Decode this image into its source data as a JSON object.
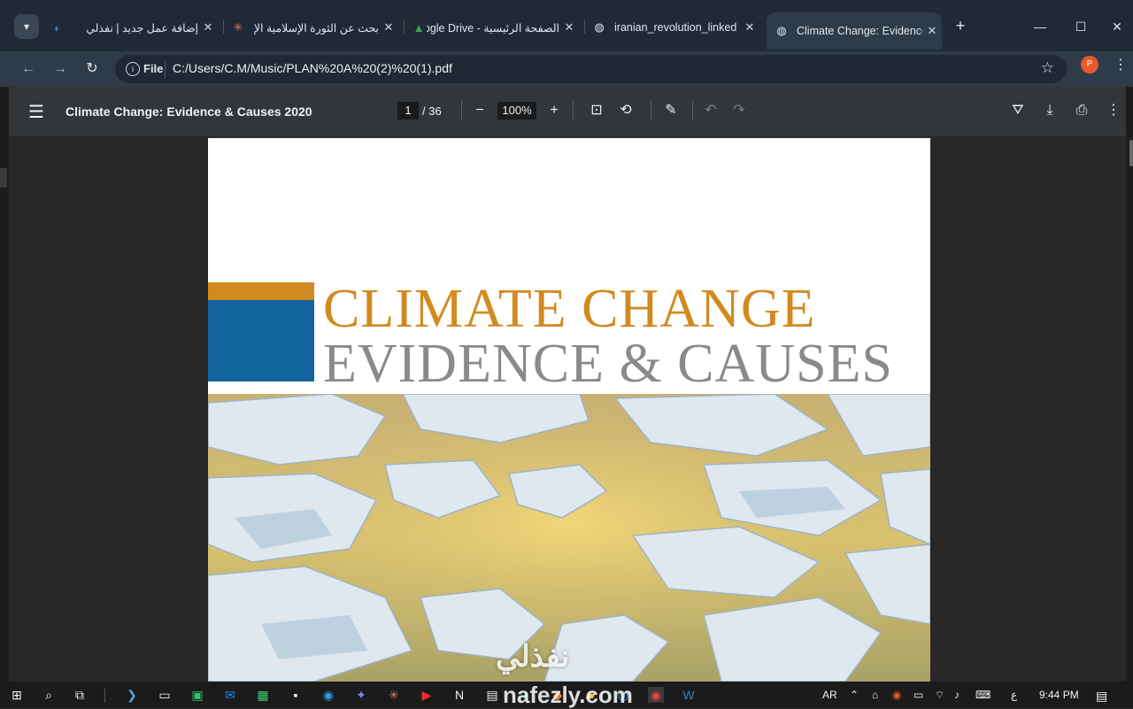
{
  "browser": {
    "tabs": [
      {
        "title": "إضافة عمل جديد | نفذلي",
        "favicon": "nafzly-icon",
        "color": "#1e88e5"
      },
      {
        "title": "بحث عن الثورة الإسلامية الإ",
        "favicon": "claude-icon",
        "color": "#d97757"
      },
      {
        "title": "الصفحة الرئيسية - Google Drive",
        "favicon": "google-drive-icon",
        "color": "#34a853"
      },
      {
        "title": "iranian_revolution_linked",
        "favicon": "globe-icon",
        "color": "#cfd6de"
      },
      {
        "title": "Climate Change: Evidence",
        "favicon": "globe-icon",
        "color": "#cfd6de",
        "active": true
      }
    ],
    "new_tab": "+",
    "url_scheme": "File",
    "url": "C:/Users/C.M/Music/PLAN%20A%20(2)%20(1).pdf",
    "profile_initial": "P"
  },
  "pdf_viewer": {
    "doc_title": "Climate Change: Evidence & Causes 2020",
    "page_current": "1",
    "page_total": "/ 36",
    "zoom": "100%"
  },
  "document": {
    "title_line1": "CLIMATE CHANGE",
    "title_line2": "EVIDENCE & CAUSES",
    "colors": {
      "orange": "#d28a20",
      "blue": "#12649e",
      "gray": "#8a8a8a"
    }
  },
  "watermark": {
    "arabic": "نفذلي",
    "latin": "nafezly.com"
  },
  "taskbar": {
    "language": "AR",
    "input_mode": "ع",
    "time": "9:44 PM"
  }
}
